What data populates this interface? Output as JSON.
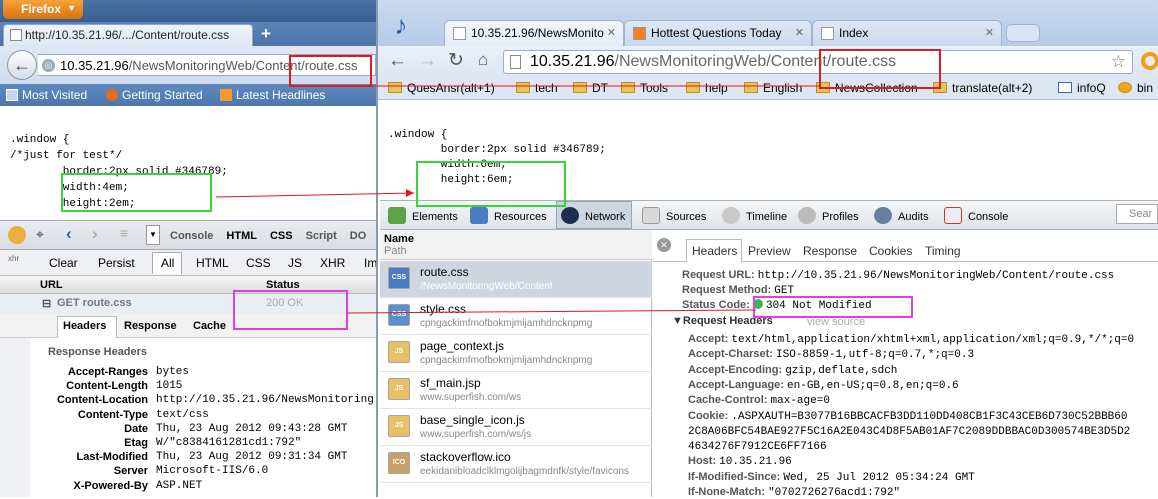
{
  "colors": {
    "annotation_red": "#e01b1b",
    "annotation_green": "#3ad43a",
    "annotation_magenta": "#e040e0",
    "status_green": "#39b54a"
  },
  "firefox": {
    "button_label": "Firefox",
    "tab_title": "http://10.35.21.96/.../Content/route.css",
    "url_host": "10.35.21.96",
    "url_path": "/NewsMonitoringWeb/Content/route.css",
    "bookmarks": [
      "Most Visited",
      "Getting Started",
      "Latest Headlines"
    ],
    "css_lines": ".window {\n/*just for test*/\n        border:2px solid #346789;\n        width:4em;\n        height:2em;",
    "firebug": {
      "panel_tabs": [
        "Console",
        "HTML",
        "CSS",
        "Script",
        "DO"
      ],
      "net_buttons": [
        "Clear",
        "Persist",
        "All",
        "HTML",
        "CSS",
        "JS",
        "XHR",
        "Im"
      ],
      "col_url": "URL",
      "col_status": "Status",
      "request": "GET route.css",
      "status": "200 OK",
      "detail_tabs": [
        "Headers",
        "Response",
        "Cache"
      ],
      "response_headers_title": "Response Headers",
      "headers": [
        {
          "k": "Accept-Ranges",
          "v": "bytes"
        },
        {
          "k": "Content-Length",
          "v": "1015"
        },
        {
          "k": "Content-Location",
          "v": "http://10.35.21.96/NewsMonitoring"
        },
        {
          "k": "Content-Type",
          "v": "text/css"
        },
        {
          "k": "Date",
          "v": "Thu, 23 Aug 2012 09:43:28 GMT"
        },
        {
          "k": "Etag",
          "v": "W/\"c8384161281cd1:792\""
        },
        {
          "k": "Last-Modified",
          "v": "Thu, 23 Aug 2012 09:31:34 GMT"
        },
        {
          "k": "Server",
          "v": "Microsoft-IIS/6.0"
        },
        {
          "k": "X-Powered-By",
          "v": "ASP.NET"
        }
      ]
    }
  },
  "chrome": {
    "tabs": [
      "10.35.21.96/NewsMonito",
      "Hottest Questions Today",
      "Index"
    ],
    "url_host": "10.35.21.96",
    "url_path": "/NewsMonitoringWeb/Content/route.css",
    "bookmarks": [
      "QuesAnsr(alt+1)",
      "tech",
      "DT",
      "Tools",
      "help",
      "English",
      "NewsCollection",
      "translate(alt+2)",
      "infoQ",
      "bin"
    ],
    "css_lines": ".window {\n        border:2px solid #346789;\n        width:6em;\n        height:6em;",
    "devtools": {
      "panels": [
        "Elements",
        "Resources",
        "Network",
        "Sources",
        "Timeline",
        "Profiles",
        "Audits",
        "Console"
      ],
      "search_placeholder": "Sear",
      "col_name": "Name",
      "col_path": "Path",
      "files": [
        {
          "name": "route.css",
          "path": "/NewsMonitoringWeb/Content",
          "type": "CSS"
        },
        {
          "name": "style.css",
          "path": "cpngackimfmofbokmjmljamhdncknpmg",
          "type": "CSS"
        },
        {
          "name": "page_context.js",
          "path": "cpngackimfmofbokmjmljamhdncknpmg",
          "type": "JS"
        },
        {
          "name": "sf_main.jsp",
          "path": "www.superfish.com/ws",
          "type": "JS"
        },
        {
          "name": "base_single_icon.js",
          "path": "www.superfish.com/ws/js",
          "type": "JS"
        },
        {
          "name": "stackoverflow.ico",
          "path": "eekidanibloadclklmgolijbagmdnfk/style/favicons",
          "type": "ICO"
        }
      ],
      "detail_tabs": [
        "Headers",
        "Preview",
        "Response",
        "Cookies",
        "Timing"
      ],
      "request_url_label": "Request URL:",
      "request_url": "http://10.35.21.96/NewsMonitoringWeb/Content/route.css",
      "method_label": "Request Method:",
      "method": "GET",
      "status_label": "Status Code:",
      "status": "304 Not Modified",
      "req_headers_title": "▼Request Headers",
      "view_source": "view source",
      "req_headers": [
        {
          "k": "Accept:",
          "v": "text/html,application/xhtml+xml,application/xml;q=0.9,*/*;q=0"
        },
        {
          "k": "Accept-Charset:",
          "v": "ISO-8859-1,utf-8;q=0.7,*;q=0.3"
        },
        {
          "k": "Accept-Encoding:",
          "v": "gzip,deflate,sdch"
        },
        {
          "k": "Accept-Language:",
          "v": "en-GB,en-US;q=0.8,en;q=0.6"
        },
        {
          "k": "Cache-Control:",
          "v": "max-age=0"
        },
        {
          "k": "Cookie:",
          "v": ".ASPXAUTH=B3077B16BBCACFB3DD110DD408CB1F3C43CEB6D730C52BBB60"
        },
        {
          "k": "",
          "v": "2C8A06BFC54BAE927F5C16A2E043C4D8F5AB01AF7C2089DDBBAC0D300574BE3D5D2"
        },
        {
          "k": "",
          "v": "4634276F7912CE6FF7166"
        },
        {
          "k": "Host:",
          "v": "10.35.21.96"
        },
        {
          "k": "If-Modified-Since:",
          "v": "Wed, 25 Jul 2012 05:34:24 GMT"
        },
        {
          "k": "If-None-Match:",
          "v": "\"0702726276acd1:792\""
        }
      ]
    }
  }
}
